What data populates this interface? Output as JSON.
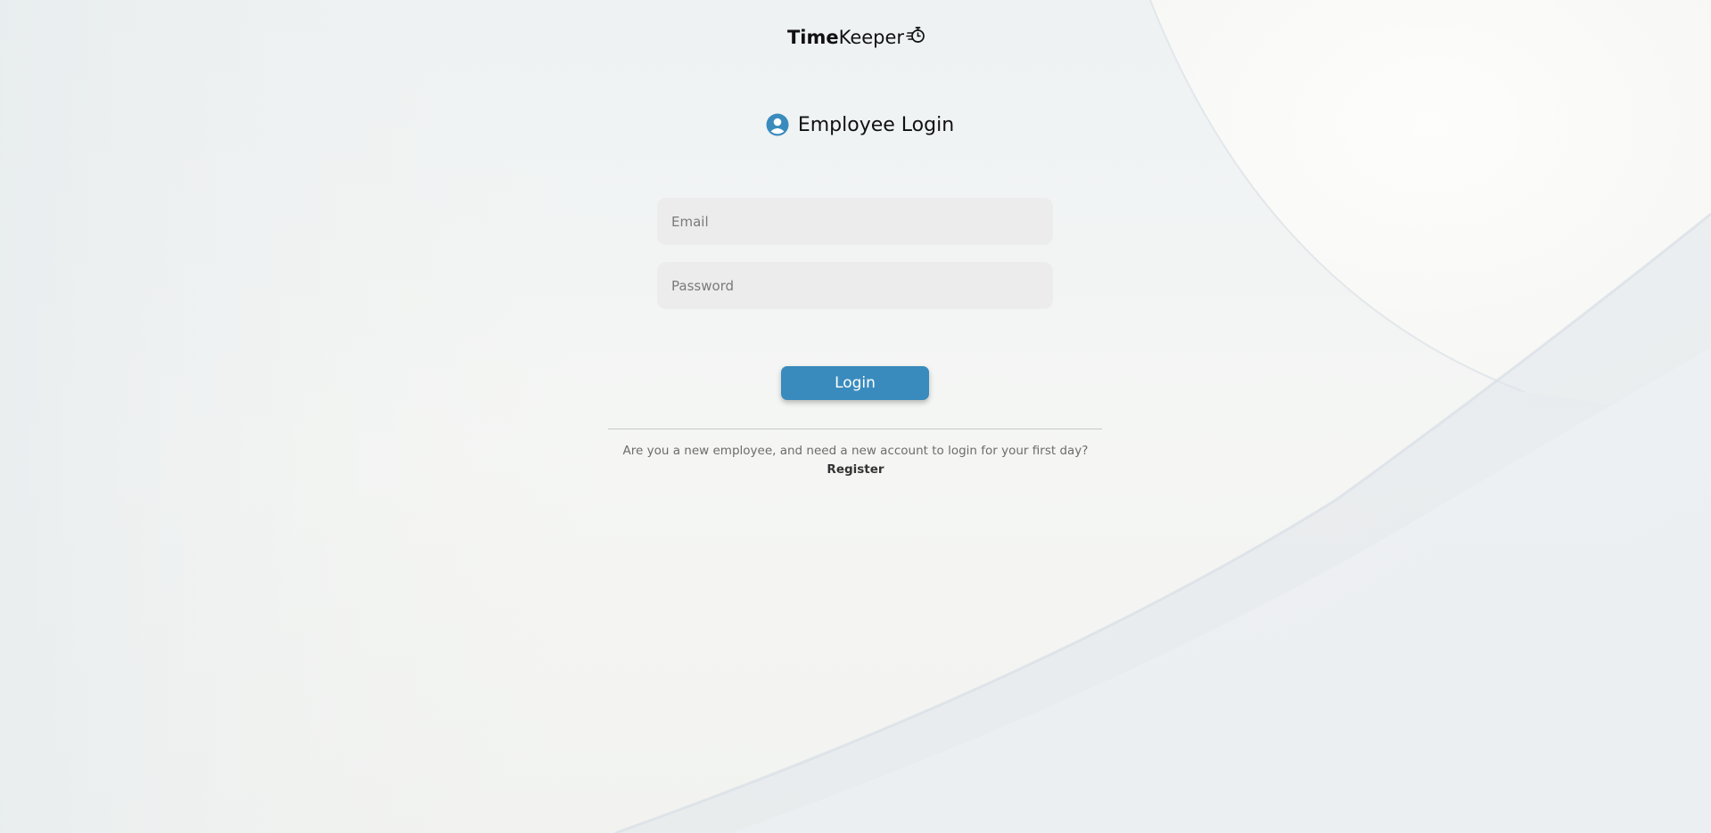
{
  "logo": {
    "bold_part": "Time",
    "normal_part": "Keeper",
    "icon": "stopwatch-icon"
  },
  "heading": {
    "icon": "user-circle-icon",
    "title": "Employee Login"
  },
  "form": {
    "email_placeholder": "Email",
    "email_value": "",
    "password_placeholder": "Password",
    "password_value": "",
    "login_label": "Login"
  },
  "footer": {
    "prompt": "Are you a new employee, and need a new account to login for your first day?",
    "register_label": "Register"
  },
  "colors": {
    "accent": "#3a8bbd",
    "field_bg": "#ececec",
    "text_dark": "#111111",
    "text_muted": "#6c6c6c"
  }
}
